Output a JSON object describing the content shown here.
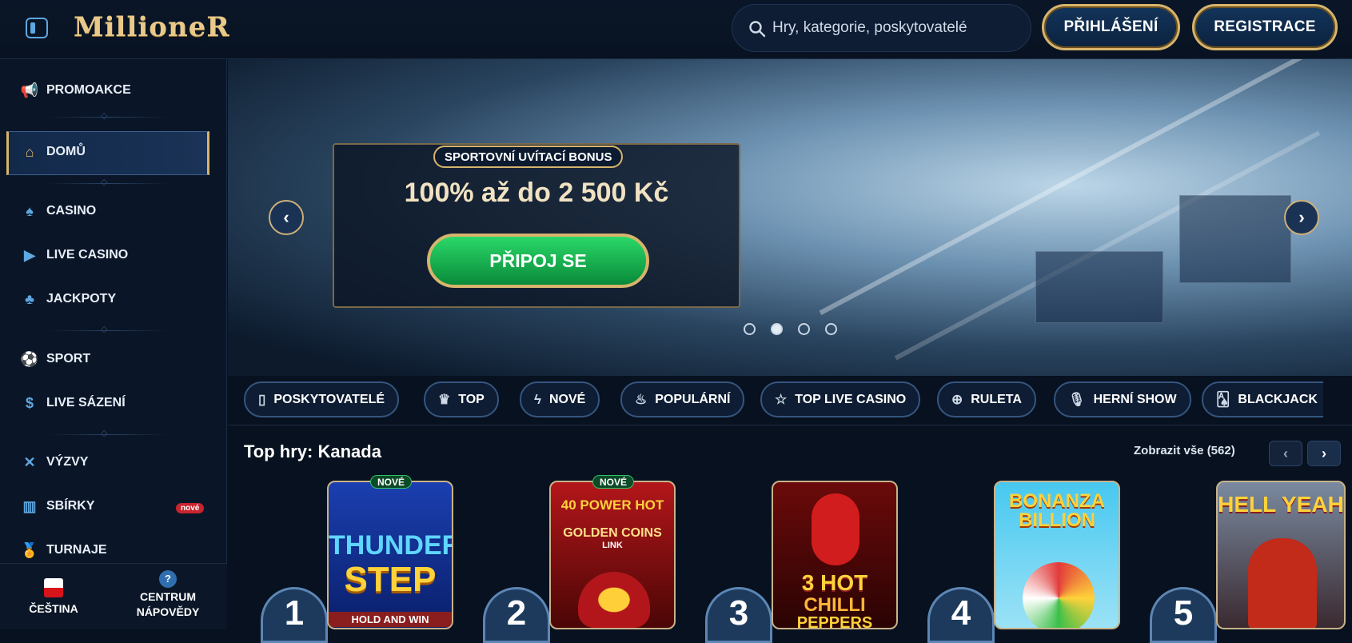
{
  "header": {
    "logo": "MillioneR",
    "search_placeholder": "Hry, kategorie, poskytovatelé",
    "login_label": "PŘIHLÁŠENÍ",
    "register_label": "REGISTRACE"
  },
  "sidebar": {
    "items": [
      {
        "label": "PROMOAKCE",
        "icon": "megaphone-icon"
      },
      {
        "label": "DOMŮ",
        "icon": "home-icon",
        "active": true
      },
      {
        "label": "CASINO",
        "icon": "spade-icon"
      },
      {
        "label": "LIVE CASINO",
        "icon": "play-chip-icon"
      },
      {
        "label": "JACKPOTY",
        "icon": "clover-icon"
      },
      {
        "label": "SPORT",
        "icon": "soccer-ball-icon"
      },
      {
        "label": "LIVE SÁZENÍ",
        "icon": "dollar-coin-icon"
      },
      {
        "label": "VÝZVY",
        "icon": "crossed-swords-icon"
      },
      {
        "label": "SBÍRKY",
        "icon": "collection-icon",
        "badge": "nové"
      },
      {
        "label": "TURNAJE",
        "icon": "medal-icon"
      }
    ],
    "footer": {
      "language": "ČEŠTINA",
      "help_line1": "CENTRUM",
      "help_line2": "NÁPOVĚDY"
    }
  },
  "hero": {
    "tag": "SPORTOVNÍ UVÍTACÍ BONUS",
    "amount": "100% až do 2 500 Kč",
    "cta": "PŘIPOJ SE",
    "slides": 4,
    "active_slide": 2
  },
  "categories": [
    {
      "label": "POSKYTOVATELÉ",
      "icon": "book-icon"
    },
    {
      "label": "TOP",
      "icon": "crown-icon"
    },
    {
      "label": "NOVÉ",
      "icon": "lightning-icon"
    },
    {
      "label": "POPULÁRNÍ",
      "icon": "flame-icon"
    },
    {
      "label": "TOP LIVE CASINO",
      "icon": "star-icon"
    },
    {
      "label": "RULETA",
      "icon": "roulette-icon"
    },
    {
      "label": "HERNÍ SHOW",
      "icon": "microphone-icon"
    },
    {
      "label": "BLACKJACK",
      "icon": "cards-icon"
    }
  ],
  "top_games": {
    "title": "Top hry: Kanada",
    "show_all": "Zobrazit vše (562)",
    "games": [
      {
        "rank": "1",
        "name_line1": "THUNDER",
        "name_line2": "STEP",
        "sub": "HOLD AND WIN",
        "tag": "NOVÉ"
      },
      {
        "rank": "2",
        "name_line1": "40 POWER HOT",
        "name_line2": "GOLDEN COINS",
        "sub": "LINK",
        "tag": "NOVÉ"
      },
      {
        "rank": "3",
        "name_line1": "3 HOT",
        "name_line2": "CHILLI",
        "sub": "PEPPERS",
        "tag": ""
      },
      {
        "rank": "4",
        "name_line1": "BONANZA",
        "name_line2": "BILLION",
        "sub": "",
        "tag": ""
      },
      {
        "rank": "5",
        "name_line1": "HELL YEAH",
        "name_line2": "",
        "sub": "",
        "tag": ""
      }
    ]
  },
  "colors": {
    "background": "#07111f",
    "accent_gold": "#d7b46c",
    "accent_blue": "#5ea7e0",
    "cta_green": "#1fbf57"
  }
}
